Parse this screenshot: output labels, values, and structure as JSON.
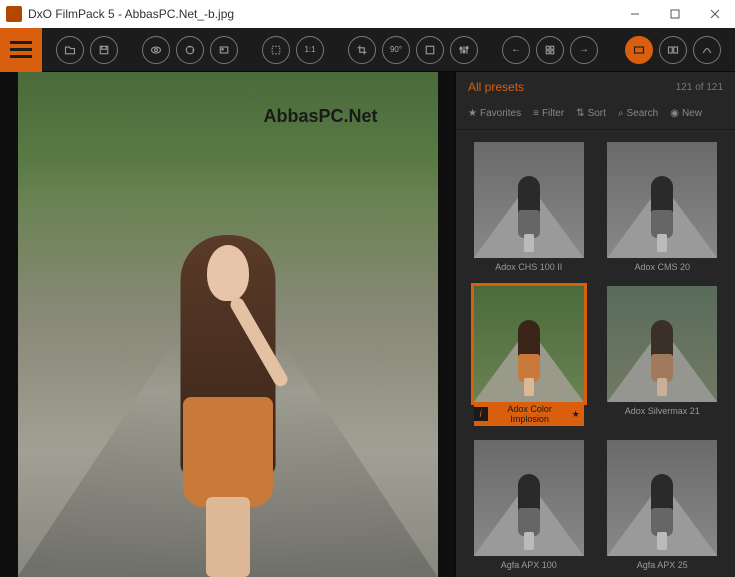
{
  "window": {
    "title": "DxO FilmPack 5 - AbbasPC.Net_-b.jpg"
  },
  "watermark": "AbbasPC.Net",
  "toolbar": {
    "icons": {
      "hamburger": "menu-icon",
      "open": "open-icon",
      "save": "save-icon",
      "view1": "eye-icon",
      "view2": "refresh-view-icon",
      "view3": "slideshow-icon",
      "fit": "fit-icon",
      "oneToOne": "1:1",
      "crop": "crop-icon",
      "rotate": "rotate-90-icon",
      "frame": "frame-icon",
      "sliders": "sliders-icon",
      "navPrev": "←",
      "navGrid": "grid-icon",
      "navNext": "→",
      "panelPresets": "presets-panel-icon",
      "panelCompare": "compare-panel-icon",
      "panelHist": "histogram-panel-icon"
    }
  },
  "sidebar": {
    "header_label": "All presets",
    "count": "121 of 121",
    "filters": {
      "favorites": "Favorites",
      "filter": "Filter",
      "sort": "Sort",
      "search": "Search",
      "new": "New"
    },
    "presets": [
      {
        "name": "Adox CHS 100 II",
        "tone": "bw",
        "selected": false
      },
      {
        "name": "Adox CMS 20",
        "tone": "bw",
        "selected": false
      },
      {
        "name": "Adox Color Implosion",
        "tone": "color",
        "selected": true
      },
      {
        "name": "Adox Silvermax 21",
        "tone": "muted",
        "selected": false
      },
      {
        "name": "Agfa APX 100",
        "tone": "bw",
        "selected": false
      },
      {
        "name": "Agfa APX 25",
        "tone": "bw",
        "selected": false
      }
    ]
  },
  "colors": {
    "accent": "#d95f0e",
    "bg": "#1e1e1e",
    "panel": "#262626"
  }
}
